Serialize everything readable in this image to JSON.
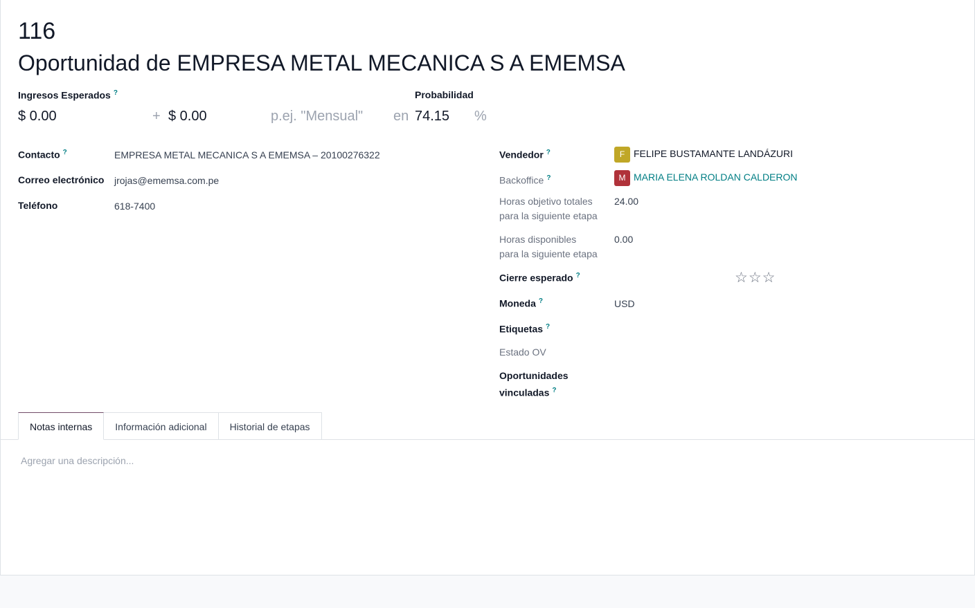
{
  "header": {
    "ref": "116",
    "title": "Oportunidad de EMPRESA METAL MECANICA S A EMEMSA"
  },
  "revenue": {
    "expected_label": "Ingresos Esperados",
    "expected_value": "$ 0.00",
    "plus": "+",
    "recurring_value": "$ 0.00",
    "recurring_plan_placeholder": "p.ej. \"Mensual\"",
    "en": "en",
    "probability_label": "Probabilidad",
    "probability_value": "74.15",
    "percent": "%"
  },
  "contact": {
    "contacto_label": "Contacto",
    "contacto_value": "EMPRESA METAL MECANICA S A EMEMSA – 20100276322",
    "email_label": "Correo electrónico",
    "email_value": "jrojas@ememsa.com.pe",
    "phone_label": "Teléfono",
    "phone_value": "618-7400"
  },
  "right": {
    "vendedor_label": "Vendedor",
    "vendedor_initial": "F",
    "vendedor_value": "FELIPE BUSTAMANTE LANDÁZURI",
    "backoffice_label": "Backoffice",
    "backoffice_initial": "M",
    "backoffice_value": "MARIA ELENA ROLDAN CALDERON",
    "horas_obj_label_1": "Horas objetivo totales",
    "horas_obj_label_2": "para la siguiente etapa",
    "horas_obj_value": "24.00",
    "horas_disp_label_1": "Horas disponibles",
    "horas_disp_label_2": "para la siguiente etapa",
    "horas_disp_value": "0.00",
    "cierre_label": "Cierre esperado",
    "priority_stars": 0,
    "moneda_label": "Moneda",
    "moneda_value": "USD",
    "etiquetas_label": "Etiquetas",
    "estado_label": "Estado OV",
    "oport_label_1": "Oportunidades",
    "oport_label_2": "vinculadas"
  },
  "colors": {
    "vendedor_avatar": "#c0a727",
    "backoffice_avatar": "#b0323a",
    "link": "#017e84",
    "active_tab": "#714b67"
  },
  "tabs": [
    "Notas internas",
    "Información adicional",
    "Historial de etapas"
  ],
  "notes": {
    "placeholder": "Agregar una descripción..."
  },
  "help_mark": "?"
}
